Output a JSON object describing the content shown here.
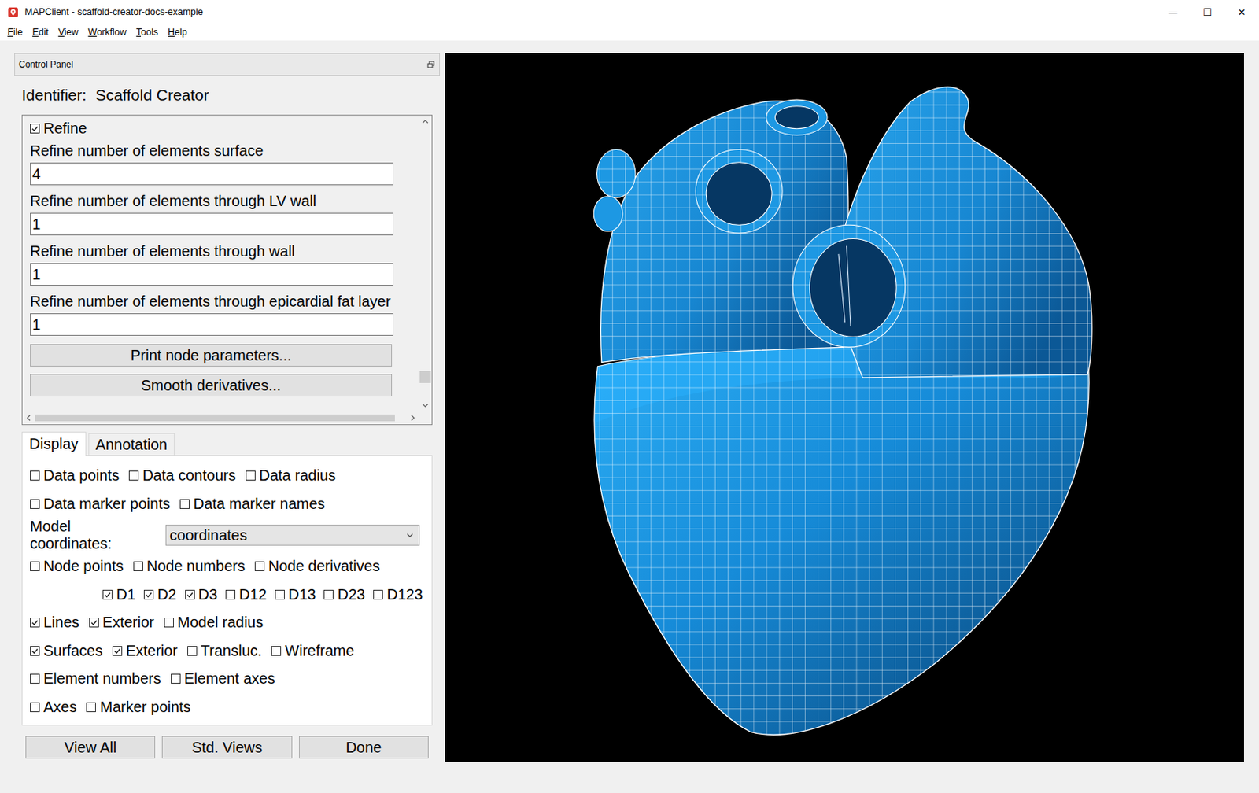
{
  "window": {
    "title": "MAPClient - scaffold-creator-docs-example",
    "controls": [
      "—",
      "☐",
      "✕"
    ]
  },
  "menu": [
    "File",
    "Edit",
    "View",
    "Workflow",
    "Tools",
    "Help"
  ],
  "control_panel": {
    "title": "Control Panel"
  },
  "identifier": {
    "label": "Identifier:",
    "value": "Scaffold Creator"
  },
  "options": {
    "scroll_level": 0.94,
    "h_scroll_level": 0,
    "refine": {
      "label": "Refine",
      "checked": true
    },
    "fields": [
      {
        "label": "Refine number of elements surface",
        "value": "4"
      },
      {
        "label": "Refine number of elements through LV wall",
        "value": "1"
      },
      {
        "label": "Refine number of elements through wall",
        "value": "1"
      },
      {
        "label": "Refine number of elements through epicardial fat layer",
        "value": "1"
      }
    ],
    "buttons": [
      "Print node parameters...",
      "Smooth derivatives..."
    ]
  },
  "tabs": [
    {
      "label": "Display",
      "selected": true
    },
    {
      "label": "Annotation",
      "selected": false
    }
  ],
  "display_rows": [
    {
      "kind": "checks",
      "items": [
        {
          "label": "Data points",
          "checked": false
        },
        {
          "label": "Data contours",
          "checked": false
        },
        {
          "label": "Data radius",
          "checked": false
        }
      ]
    },
    {
      "kind": "checks",
      "items": [
        {
          "label": "Data marker points",
          "checked": false
        },
        {
          "label": "Data marker names",
          "checked": false
        }
      ]
    },
    {
      "kind": "select",
      "label": "Model coordinates:",
      "value": "coordinates"
    },
    {
      "kind": "checks",
      "items": [
        {
          "label": "Node points",
          "checked": false
        },
        {
          "label": "Node numbers",
          "checked": false
        },
        {
          "label": "Node derivatives",
          "checked": false
        }
      ]
    },
    {
      "kind": "subchecks",
      "items": [
        {
          "label": "D1",
          "checked": true
        },
        {
          "label": "D2",
          "checked": true
        },
        {
          "label": "D3",
          "checked": true
        },
        {
          "label": "D12",
          "checked": false
        },
        {
          "label": "D13",
          "checked": false
        },
        {
          "label": "D23",
          "checked": false
        },
        {
          "label": "D123",
          "checked": false
        }
      ]
    },
    {
      "kind": "checks",
      "items": [
        {
          "label": "Lines",
          "checked": true
        },
        {
          "label": "Exterior",
          "checked": true
        },
        {
          "label": "Model radius",
          "checked": false
        }
      ]
    },
    {
      "kind": "checks",
      "items": [
        {
          "label": "Surfaces",
          "checked": true
        },
        {
          "label": "Exterior",
          "checked": true
        },
        {
          "label": "Transluc.",
          "checked": false
        },
        {
          "label": "Wireframe",
          "checked": false
        }
      ]
    },
    {
      "kind": "checks",
      "items": [
        {
          "label": "Element numbers",
          "checked": false
        },
        {
          "label": "Element axes",
          "checked": false
        }
      ]
    },
    {
      "kind": "checks",
      "items": [
        {
          "label": "Axes",
          "checked": false
        },
        {
          "label": "Marker points",
          "checked": false
        }
      ]
    }
  ],
  "buttons": [
    "View All",
    "Std. Views",
    "Done"
  ]
}
